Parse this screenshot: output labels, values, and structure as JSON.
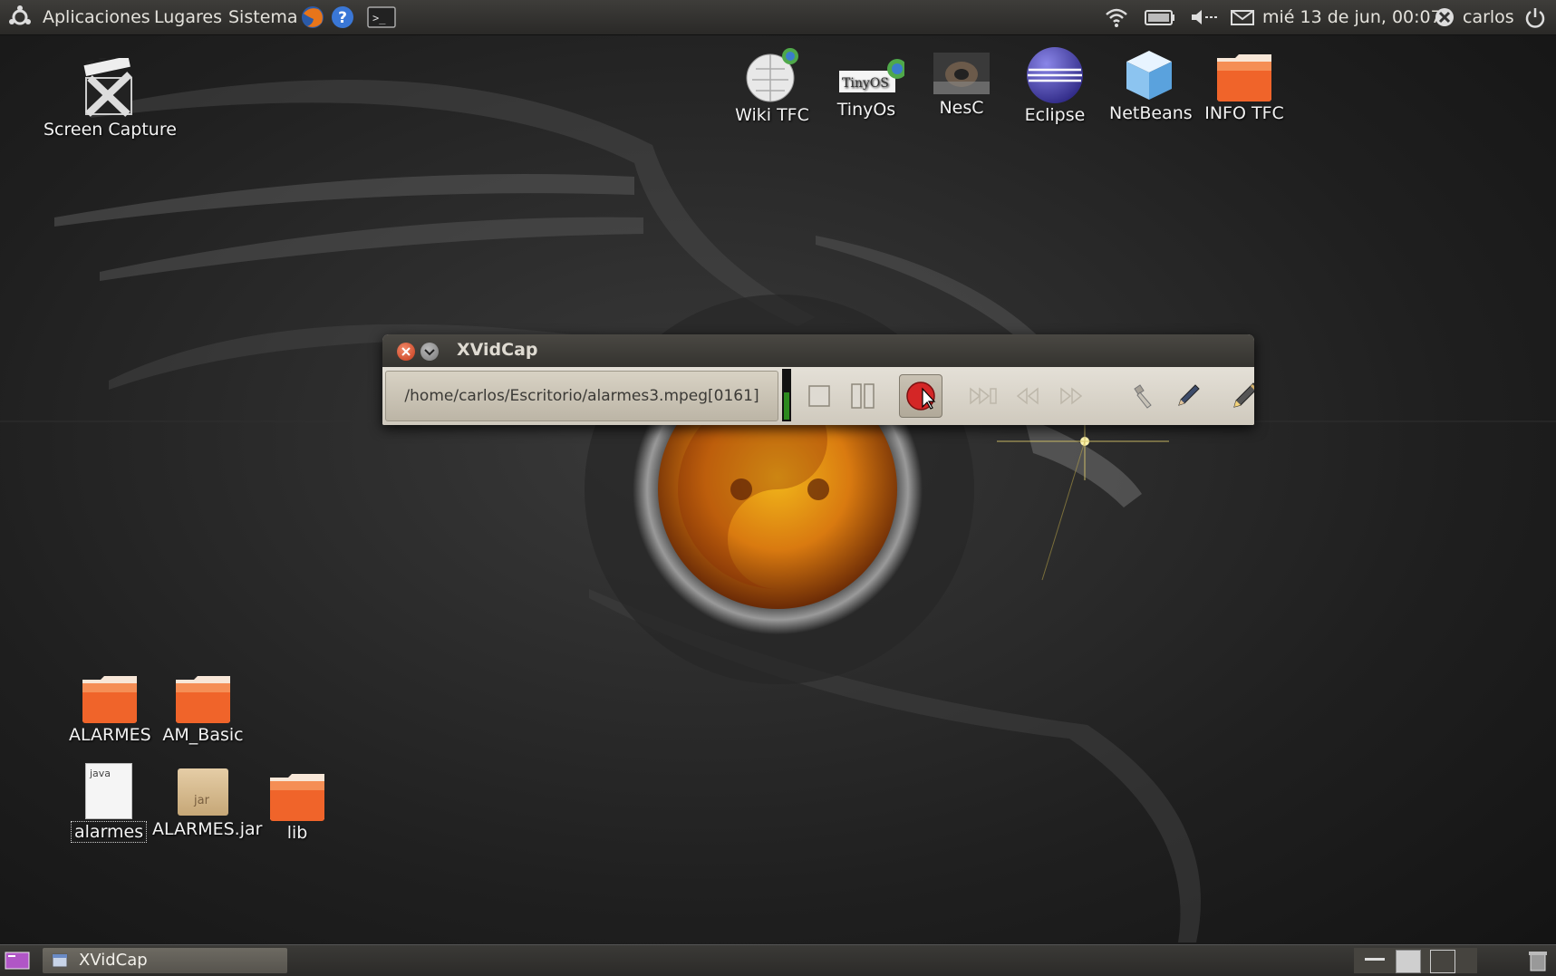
{
  "top_panel": {
    "menu_items": [
      "Aplicaciones",
      "Lugares",
      "Sistema"
    ],
    "launchers": [
      "firefox-icon",
      "help-icon",
      "terminal-icon"
    ],
    "clock": "mié 13 de jun, 00:07",
    "user": "carlos",
    "indicators": [
      "wifi-icon",
      "battery-icon",
      "volume-icon",
      "mail-icon",
      "user-icon",
      "power-icon"
    ]
  },
  "desktop_icons": {
    "screen_capture": "Screen Capture",
    "wiki_tfc": "Wiki TFC",
    "tinyos": "TinyOs",
    "tinyos_logo_text": "TinyOS",
    "nesc": "NesC",
    "eclipse": "Eclipse",
    "netbeans": "NetBeans",
    "info_tfc": "INFO TFC",
    "alarmes_folder": "ALARMES",
    "am_basic": "AM_Basic",
    "alarmes_java": "alarmes",
    "java_badge": "java",
    "alarmes_jar": "ALARMES.jar",
    "jar_badge": "jar",
    "lib": "lib"
  },
  "xvidcap": {
    "title": "XVidCap",
    "file_path": "/home/carlos/Escritorio/alarmes3.mpeg[0161]",
    "buttons": [
      "stop",
      "pause",
      "record",
      "step",
      "rewind",
      "forward",
      "filename",
      "edit",
      "annotate"
    ]
  },
  "taskbar": {
    "window_label": "XVidCap"
  },
  "colors": {
    "panel": "#3a3936",
    "desktop": "#1b1b1b",
    "folder": "#f0642a",
    "record": "#cc2222"
  }
}
